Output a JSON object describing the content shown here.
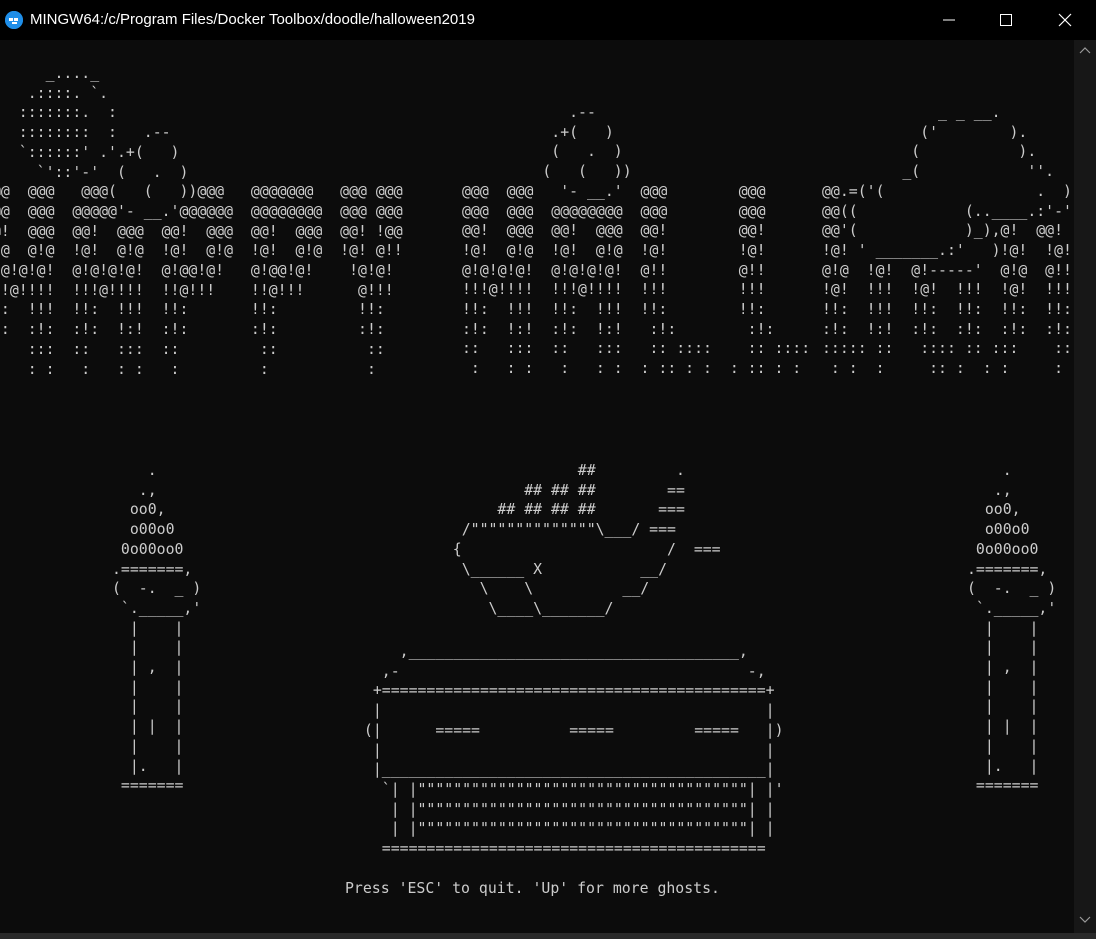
{
  "window": {
    "title": "MINGW64:/c/Program Files/Docker Toolbox/doodle/halloween2019",
    "app_icon": "mingw-terminal-icon",
    "controls": [
      "minimize-icon",
      "maximize-icon",
      "close-icon"
    ]
  },
  "colors": {
    "background": "#0c0c0c",
    "text": "#cccccc",
    "titlebar": "#000000",
    "icon_accent": "#1f8ee8"
  },
  "terminal": {
    "banner_art": "      _...._\n    .::::. `.\n   :::::::.  :\n   ::::::::  :   .--\n   `::::::' .'.+(   )\n     `'::'-'  (   .  )\n@@  @@@   @@@(   (   ))@@@   @@@@@@@   @@@ @@@\n@@  @@@  @@@@@'- __.'@@@@@@  @@@@@@@@  @@@ @@@\n@!  @@@  @@!  @@@  @@!  @@@  @@!  @@@  @@! !@@\n!@  @!@  !@!  @!@  !@!  @!@  !@!  @!@  !@! @!!\n!@!@!@!  @!@!@!@!  @!@@!@!   @!@@!@!    !@!@!\n!!@!!!!  !!!@!!!!  !!@!!!    !!@!!!      @!!!\n!:  !!!  !!:  !!!  !!:       !!:         !!:\n!:  :!:  :!:  !:!  :!:       :!:         :!:\n:   :::  ::   :::  ::         ::          ::\n:   : :   :   : :   :         :           :",
    "banner_art_mid": "            .--\n          .+(   )\n          (   .  )\n         (   (   ))\n@@@  @@@   '- __.'  @@@        @@@\n@@@  @@@  @@@@@@@@  @@@        @@@\n@@!  @@@  @@!  @@@  @@!        @@!\n!@!  @!@  !@!  @!@  !@!        !@!\n@!@!@!@!  @!@!@!@!  @!!        @!!\n!!!@!!!!  !!!@!!!!  !!!        !!!\n!!:  !!!  !!:  !!!  !!:        !!:\n:!:  !:!  :!:  !:!   :!:        :!:\n::   :::  ::   :::   :: ::::    :: ::::\n :   : :   :   : :  : :: : :  : :: : :",
    "banner_art_right": "             _ _ __.\n           ('        ).\n          (           ).\n         _(            ''.\n@@.=('(                 .  ) @@@\n@@((            (..____.:'-' @@@\n@@'(            )_),@!  @@!  @@!\n!@! ' _______.:'   )!@!  !@!\n@!@  !@!  @!-----'  @!@  @!!\n!@!  !!!  !@!  !!!  !@!  !!!\n!!:  !!!  !!:  !!:  !!:  !!:\n:!:  !:!  :!:  :!:  :!:  :!:\n::::: ::   :::: :: :::    ::\n : :  :     :: :  : :     :",
    "torch_art": "    .\n   .,\n  oo0,\n  o00o0\n 0o00oo0\n.=======,\n(  -.  _ )\n `._____,'\n  |    |\n  |    |\n  | ,  |\n  |    |\n  |    |\n  | |  |\n  |    |\n  |.   |\n =======",
    "cauldron_art": "                 ##         .\n           ## ## ##        ==\n        ## ## ## ##       ===\n    /\"\"\"\"\"\"\"\"\"\"\"\"\"\"\\___/ ===\n   {                       /  ===\n    \\______ X           __/\n      \\    \\          __/\n       \\____\\_______/",
    "coffin_art": "     ,_____________________________________,\n   ,-                                       -,\n  +===========================================+\n  |                                           |\n (|      =====          =====         =====   |)\n  |                                           |\n  |___________________________________________|\n   `| |\"\"\"\"\"\"\"\"\"\"\"\"\"\"\"\"\"\"\"\"\"\"\"\"\"\"\"\"\"\"\"\"\"\"\"\"\"| |'\n    | |\"\"\"\"\"\"\"\"\"\"\"\"\"\"\"\"\"\"\"\"\"\"\"\"\"\"\"\"\"\"\"\"\"\"\"\"\"| |\n    | |\"\"\"\"\"\"\"\"\"\"\"\"\"\"\"\"\"\"\"\"\"\"\"\"\"\"\"\"\"\"\"\"\"\"\"\"\"| |\n   ===========================================",
    "prompt": "Press 'ESC' to quit. 'Up' for more ghosts."
  }
}
